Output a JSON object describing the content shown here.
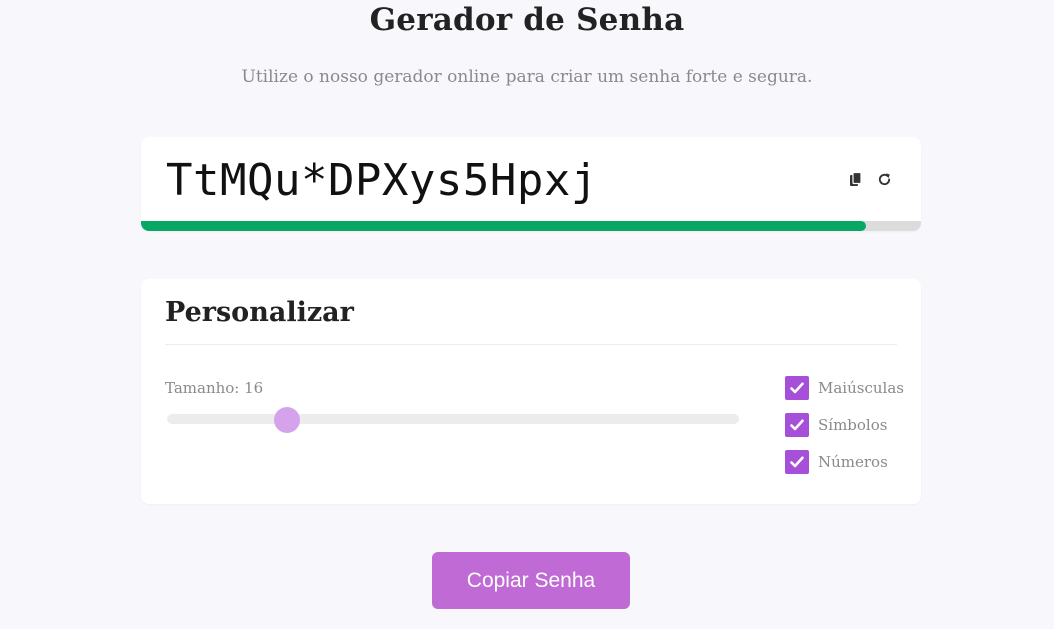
{
  "header": {
    "title": "Gerador de Senha",
    "subtitle": "Utilize o nosso gerador online para criar um senha forte e segura."
  },
  "password": {
    "value": "TtMQu*DPXys5Hpxj",
    "strength_fraction": 0.93,
    "strength_color": "#08a864",
    "icons": {
      "copy": "copy-icon",
      "refresh": "refresh-icon"
    }
  },
  "customize": {
    "title": "Personalizar",
    "length_label": "Tamanho: 16",
    "length_value": 16,
    "slider_fraction": 0.21,
    "options": [
      {
        "label": "Maiúsculas",
        "checked": true
      },
      {
        "label": "Símbolos",
        "checked": true
      },
      {
        "label": "Números",
        "checked": true
      }
    ],
    "accent_color": "#a64fd9"
  },
  "actions": {
    "copy_label": "Copiar Senha",
    "button_color": "#c06ad5"
  }
}
